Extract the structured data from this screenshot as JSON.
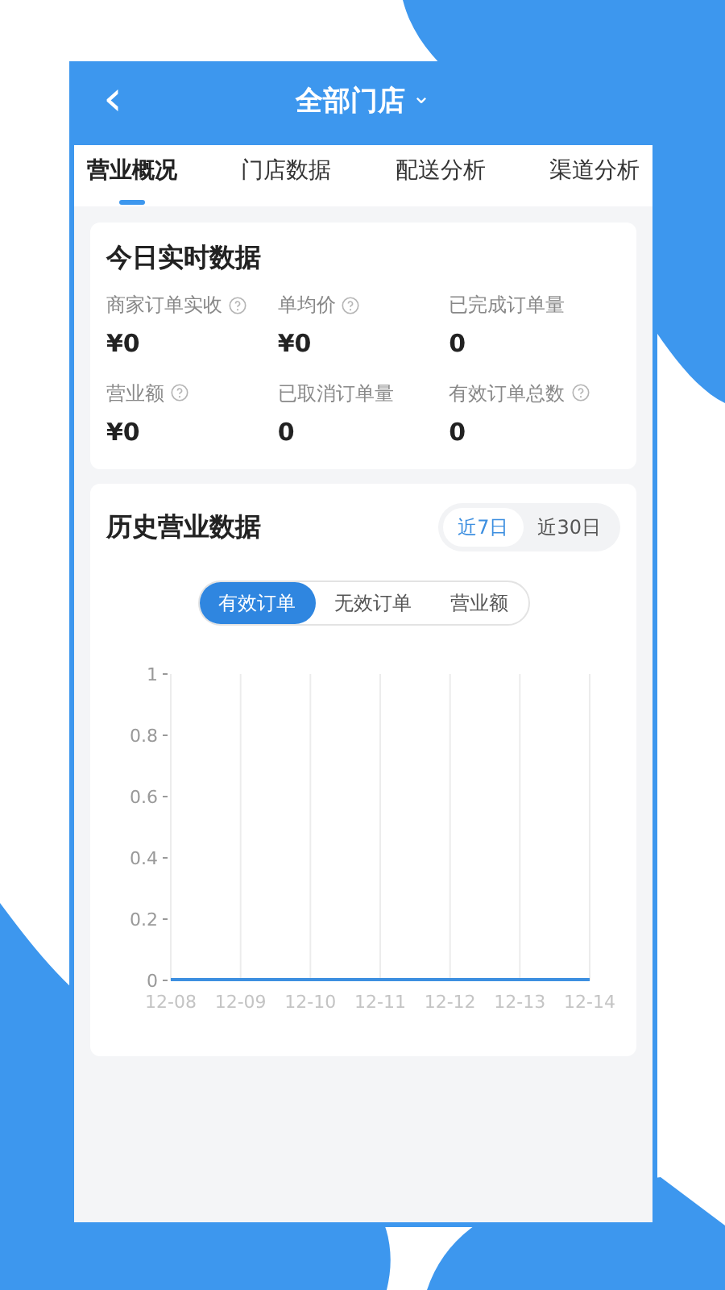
{
  "header": {
    "back": "‹",
    "title": "全部门店",
    "dropdown": "⌄"
  },
  "tabs": [
    {
      "label": "营业概况",
      "selected": true
    },
    {
      "label": "门店数据",
      "selected": false
    },
    {
      "label": "配送分析",
      "selected": false
    },
    {
      "label": "渠道分析",
      "selected": false
    }
  ],
  "realtime": {
    "title": "今日实时数据",
    "metrics": [
      {
        "label": "商家订单实收",
        "help": true,
        "value": "¥0"
      },
      {
        "label": "单均价",
        "help": true,
        "value": "¥0"
      },
      {
        "label": "已完成订单量",
        "help": false,
        "value": "0"
      },
      {
        "label": "营业额",
        "help": true,
        "value": "¥0"
      },
      {
        "label": "已取消订单量",
        "help": false,
        "value": "0"
      },
      {
        "label": "有效订单总数",
        "help": true,
        "value": "0"
      }
    ]
  },
  "history": {
    "title": "历史营业数据",
    "ranges": [
      {
        "label": "近7日",
        "selected": true
      },
      {
        "label": "近30日",
        "selected": false
      }
    ],
    "segments": [
      {
        "label": "有效订单",
        "selected": true
      },
      {
        "label": "无效订单",
        "selected": false
      },
      {
        "label": "营业额",
        "selected": false
      }
    ],
    "chart_data": {
      "type": "line",
      "categories": [
        "12-08",
        "12-09",
        "12-10",
        "12-11",
        "12-12",
        "12-13",
        "12-14"
      ],
      "series": [
        {
          "color": "#3d8fe0",
          "values": [
            0,
            0,
            0,
            0,
            0,
            0,
            0
          ]
        }
      ],
      "grid": true,
      "ylim": [
        0,
        1
      ],
      "yticks": [
        0,
        0.2,
        0.4,
        0.6,
        0.8,
        1
      ]
    }
  }
}
